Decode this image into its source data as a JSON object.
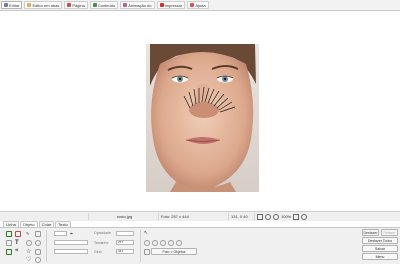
{
  "topbar": {
    "tabs": [
      {
        "label": "Editar",
        "color": "#6a7fb0",
        "active": true
      },
      {
        "label": "Editor em abas",
        "color": "#d6b35a"
      },
      {
        "label": "Página",
        "color": "#d24b4b"
      },
      {
        "label": "Conteúdo",
        "color": "#4a8c4a"
      },
      {
        "label": "Animação do",
        "color": "#c45c9a"
      },
      {
        "label": "Impressor",
        "color": "#cc3333"
      },
      {
        "label": "Ajuda",
        "color": "#e05050"
      }
    ]
  },
  "status": {
    "filename": "rosto.jpg",
    "photo_size": "Foto: 257 x 444",
    "coords": "131, 0  40",
    "zoom": "100%"
  },
  "panel_tabs": [
    "Linha",
    "Objeto",
    "Colar",
    "Texto"
  ],
  "panel": {
    "labels": {
      "opacity": "Opacidade",
      "size": "Tamanho",
      "rotation": "Girar"
    },
    "values": {
      "size": "257",
      "rotation": "444"
    },
    "buttons": {
      "photo_to_object": "Foto > Objetos",
      "undo": "Desfazer",
      "redo": "Refazer",
      "undo_all": "Desfazer Todos",
      "save": "Salvar",
      "menu": "Menu"
    }
  }
}
